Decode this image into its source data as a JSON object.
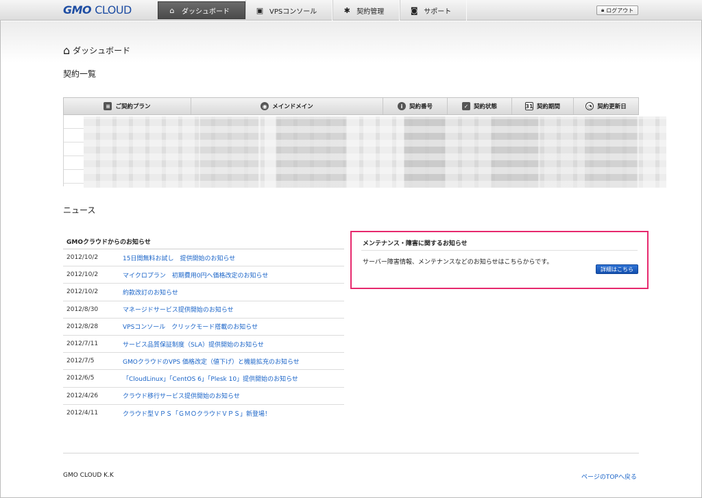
{
  "header": {
    "logo_gmo": "GMO",
    "logo_cloud": "CLOUD",
    "nav": [
      {
        "icon": "home-icon",
        "label": "ダッシュボード",
        "active": true
      },
      {
        "icon": "console-icon",
        "label": "VPSコンソール",
        "active": false
      },
      {
        "icon": "gear-icon",
        "label": "契約管理",
        "active": false
      },
      {
        "icon": "camera-icon",
        "label": "サポート",
        "active": false
      }
    ],
    "logout_label": "ログアウト"
  },
  "page": {
    "title": "ダッシュボード",
    "contracts_heading": "契約一覧",
    "news_heading": "ニュース"
  },
  "contracts_table": {
    "columns": [
      "ご契約プラン",
      "メインドメイン",
      "契約番号",
      "契約状態",
      "契約期間",
      "契約更新日"
    ]
  },
  "news_gmo": {
    "heading": "GMOクラウドからのお知らせ",
    "items": [
      {
        "date": "2012/10/2",
        "title": "15日間無料お試し　提供開始のお知らせ"
      },
      {
        "date": "2012/10/2",
        "title": "マイクロプラン　初期費用0円へ価格改定のお知らせ"
      },
      {
        "date": "2012/10/2",
        "title": "約款改訂のお知らせ"
      },
      {
        "date": "2012/8/30",
        "title": "マネージドサービス提供開始のお知らせ"
      },
      {
        "date": "2012/8/28",
        "title": "VPSコンソール　クリックモード搭載のお知らせ"
      },
      {
        "date": "2012/7/11",
        "title": "サービス品質保証制度（SLA）提供開始のお知らせ"
      },
      {
        "date": "2012/7/5",
        "title": "GMOクラウドのVPS 価格改定（値下げ）と機能拡充のお知らせ"
      },
      {
        "date": "2012/6/5",
        "title": "「CloudLinux」「CentOS 6」「Plesk 10」提供開始のお知らせ"
      },
      {
        "date": "2012/4/26",
        "title": "クラウド移行サービス提供開始のお知らせ"
      },
      {
        "date": "2012/4/11",
        "title": "クラウド型ＶＰＳ「ＧＭＯクラウドＶＰＳ」新登場！"
      }
    ]
  },
  "maintenance": {
    "heading": "メンテナンス・障害に関するお知らせ",
    "text": "サーバー障害情報、メンテナンスなどのお知らせはこちらからです。",
    "button": "詳細はこちら"
  },
  "footer": {
    "company": "GMO CLOUD K.K",
    "back_to_top": "ページのTOPへ戻る"
  }
}
